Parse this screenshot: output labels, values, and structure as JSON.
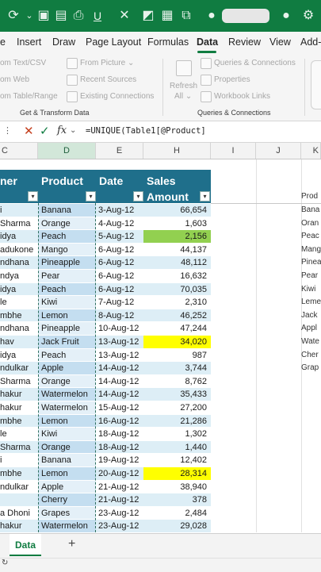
{
  "ribbon_tabs": [
    "e",
    "Insert",
    "Draw",
    "Page Layout",
    "Formulas",
    "Data",
    "Review",
    "View",
    "Add-"
  ],
  "active_tab": "Data",
  "ribbon": {
    "get_data": [
      "om Text/CSV",
      "om Web",
      "om Table/Range"
    ],
    "from_picture": "From Picture",
    "recent_sources": "Recent Sources",
    "existing_connections": "Existing Connections",
    "group_get_transform": "Get & Transform Data",
    "refresh_all": "Refresh",
    "refresh_all2": "All",
    "queries_connections": "Queries & Connections",
    "properties": "Properties",
    "workbook_links": "Workbook Links",
    "group_queries": "Queries & Connections"
  },
  "formula_bar": {
    "fx": "fx",
    "formula": "=UNIQUE(Table1[@Product]"
  },
  "columns": [
    "C",
    "D",
    "E",
    "H",
    "I",
    "J",
    "K"
  ],
  "table_headers": {
    "name": "ner",
    "product": "Product",
    "date": "Date",
    "sales1": "Sales",
    "sales2": "Amount"
  },
  "rows": [
    {
      "name": "i",
      "product": "Banana",
      "date": "3-Aug-12",
      "amount": "66,654",
      "hl": ""
    },
    {
      "name": "Sharma",
      "product": "Orange",
      "date": "4-Aug-12",
      "amount": "1,603",
      "hl": ""
    },
    {
      "name": "idya",
      "product": "Peach",
      "date": "5-Aug-12",
      "amount": "2,156",
      "hl": "green"
    },
    {
      "name": "adukone",
      "product": "Mango",
      "date": "6-Aug-12",
      "amount": "44,137",
      "hl": ""
    },
    {
      "name": "ndhana",
      "product": "Pineapple",
      "date": "6-Aug-12",
      "amount": "48,112",
      "hl": ""
    },
    {
      "name": "ndya",
      "product": "Pear",
      "date": "6-Aug-12",
      "amount": "16,632",
      "hl": ""
    },
    {
      "name": "idya",
      "product": "Peach",
      "date": "6-Aug-12",
      "amount": "70,035",
      "hl": ""
    },
    {
      "name": "le",
      "product": "Kiwi",
      "date": "7-Aug-12",
      "amount": "2,310",
      "hl": ""
    },
    {
      "name": "mbhe",
      "product": "Lemon",
      "date": "8-Aug-12",
      "amount": "46,252",
      "hl": ""
    },
    {
      "name": "ndhana",
      "product": "Pineapple",
      "date": "10-Aug-12",
      "amount": "47,244",
      "hl": ""
    },
    {
      "name": "hav",
      "product": "Jack Fruit",
      "date": "13-Aug-12",
      "amount": "34,020",
      "hl": "yellow"
    },
    {
      "name": "idya",
      "product": "Peach",
      "date": "13-Aug-12",
      "amount": "987",
      "hl": ""
    },
    {
      "name": "ndulkar",
      "product": "Apple",
      "date": "14-Aug-12",
      "amount": "3,744",
      "hl": ""
    },
    {
      "name": "Sharma",
      "product": "Orange",
      "date": "14-Aug-12",
      "amount": "8,762",
      "hl": ""
    },
    {
      "name": "hakur",
      "product": "Watermelon",
      "date": "14-Aug-12",
      "amount": "35,433",
      "hl": ""
    },
    {
      "name": "hakur",
      "product": "Watermelon",
      "date": "15-Aug-12",
      "amount": "27,200",
      "hl": ""
    },
    {
      "name": "mbhe",
      "product": "Lemon",
      "date": "16-Aug-12",
      "amount": "21,286",
      "hl": ""
    },
    {
      "name": "le",
      "product": "Kiwi",
      "date": "18-Aug-12",
      "amount": "1,302",
      "hl": ""
    },
    {
      "name": "Sharma",
      "product": "Orange",
      "date": "18-Aug-12",
      "amount": "1,440",
      "hl": ""
    },
    {
      "name": "i",
      "product": "Banana",
      "date": "19-Aug-12",
      "amount": "12,402",
      "hl": ""
    },
    {
      "name": "mbhe",
      "product": "Lemon",
      "date": "20-Aug-12",
      "amount": "28,314",
      "hl": "yellow"
    },
    {
      "name": "ndulkar",
      "product": "Apple",
      "date": "21-Aug-12",
      "amount": "38,940",
      "hl": ""
    },
    {
      "name": "",
      "product": "Cherry",
      "date": "21-Aug-12",
      "amount": "378",
      "hl": ""
    },
    {
      "name": "a Dhoni",
      "product": "Grapes",
      "date": "23-Aug-12",
      "amount": "2,484",
      "hl": ""
    },
    {
      "name": "hakur",
      "product": "Watermelon",
      "date": "23-Aug-12",
      "amount": "29,028",
      "hl": ""
    }
  ],
  "product_list_header": "Prod",
  "product_list": [
    "Bana",
    "Oran",
    "Peac",
    "Mang",
    "Pinea",
    "Pear",
    "Kiwi",
    "Leme",
    "Jack",
    "Appl",
    "Wate",
    "Cher",
    "Grap"
  ],
  "sheet_tab": "Data",
  "add_sheet": "+",
  "colors": {
    "excel_green": "#107c41",
    "table_header": "#1f6f8b",
    "row_light": "#ddeef6",
    "row_white": "#ffffff",
    "highlight_green": "#92d050",
    "highlight_yellow": "#ffff00"
  }
}
